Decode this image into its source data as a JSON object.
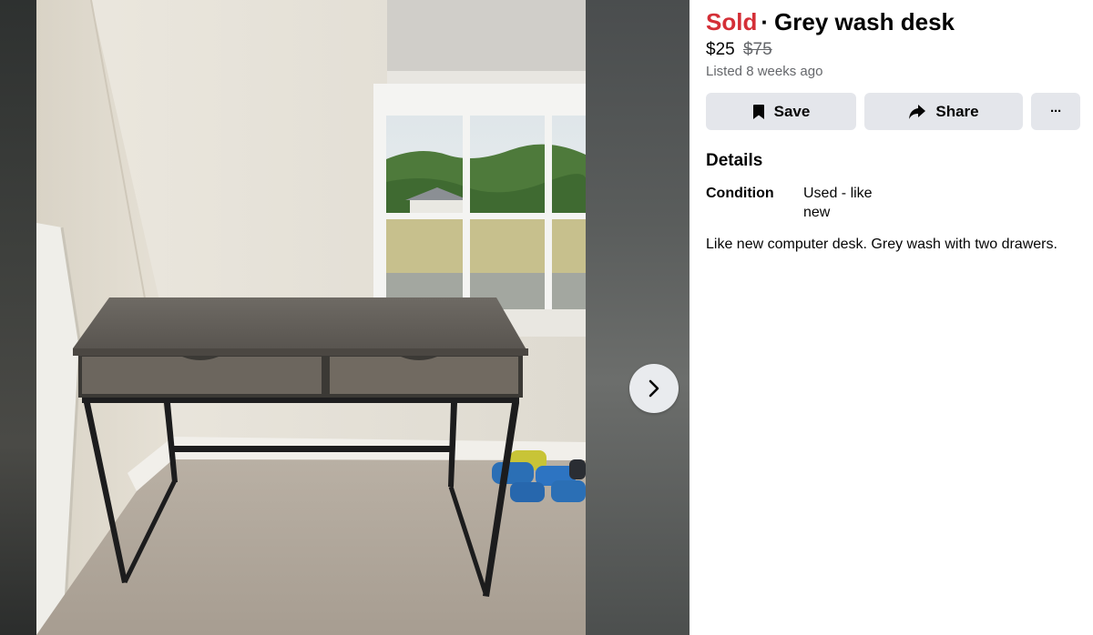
{
  "listing": {
    "status": "Sold",
    "separator": "·",
    "title": "Grey wash desk",
    "price": "$25",
    "original_price": "$75",
    "listed": "Listed 8 weeks ago"
  },
  "actions": {
    "save_label": "Save",
    "share_label": "Share",
    "more_label": "···"
  },
  "details": {
    "heading": "Details",
    "condition_label": "Condition",
    "condition_value": "Used - like new",
    "description": "Like new computer desk. Grey wash with two drawers."
  },
  "colors": {
    "sold_accent": "#d42f37",
    "button_bg": "#e4e6eb",
    "secondary_text": "#65676b"
  },
  "icons": {
    "save": "bookmark-icon",
    "share": "share-arrow-icon",
    "next": "chevron-right-icon"
  }
}
